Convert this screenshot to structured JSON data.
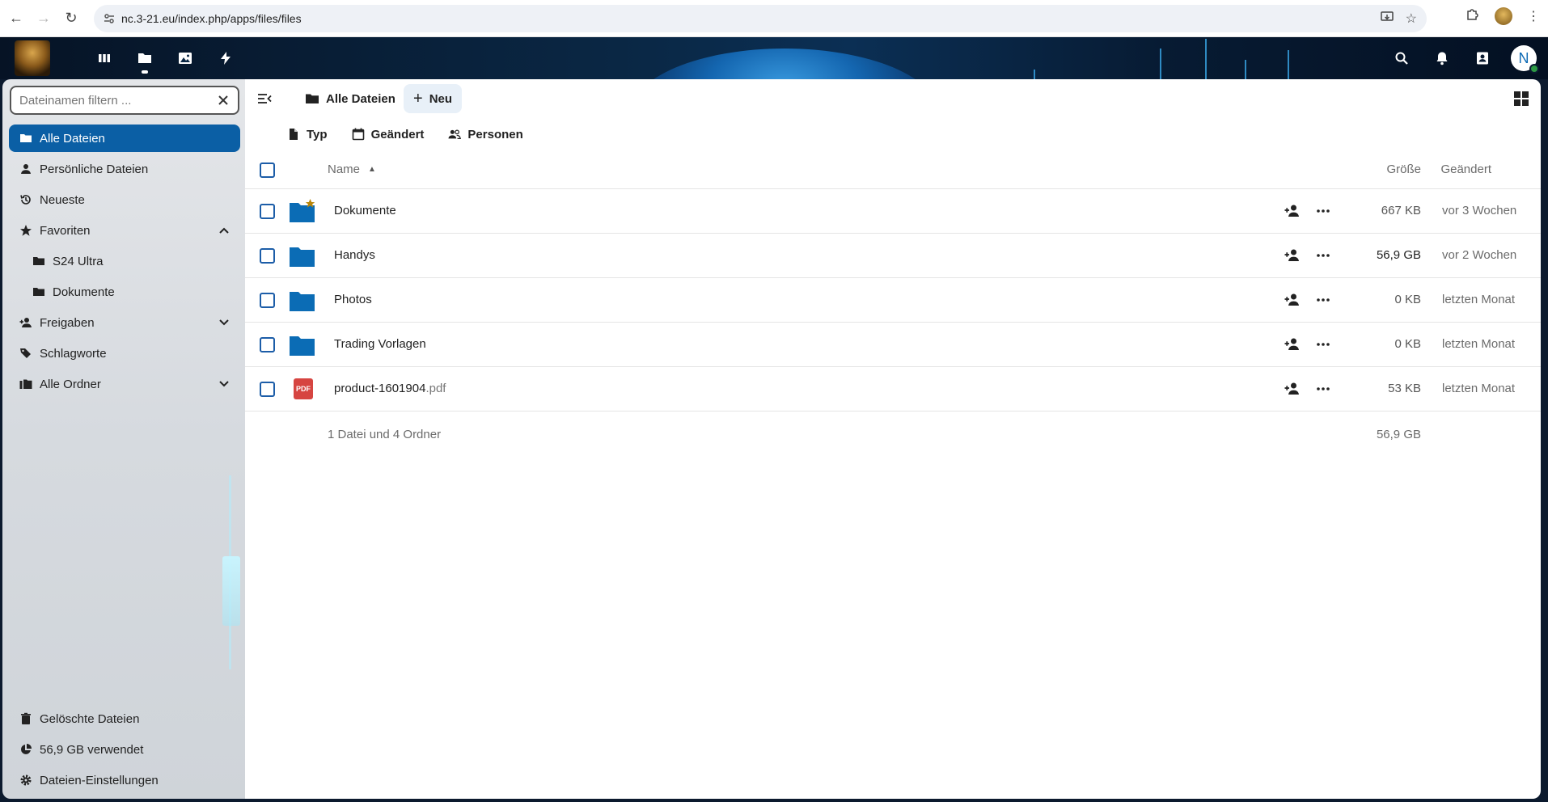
{
  "browser": {
    "url": "nc.3-21.eu/index.php/apps/files/files"
  },
  "sidebar": {
    "filter_placeholder": "Dateinamen filtern ...",
    "items": [
      {
        "label": "Alle Dateien",
        "icon": "folder-icon",
        "active": true
      },
      {
        "label": "Persönliche Dateien",
        "icon": "person-icon"
      },
      {
        "label": "Neueste",
        "icon": "history-icon"
      },
      {
        "label": "Favoriten",
        "icon": "star-icon"
      },
      {
        "label": "S24 Ultra",
        "icon": "folder-icon"
      },
      {
        "label": "Dokumente",
        "icon": "folder-icon"
      },
      {
        "label": "Freigaben",
        "icon": "share-icon"
      },
      {
        "label": "Schlagworte",
        "icon": "tag-icon"
      },
      {
        "label": "Alle Ordner",
        "icon": "folders-icon"
      }
    ],
    "bottom": {
      "trash": "Gelöschte Dateien",
      "quota": "56,9 GB verwendet",
      "settings": "Dateien-Einstellungen"
    }
  },
  "toolbar": {
    "breadcrumb": "Alle Dateien",
    "new_label": "Neu"
  },
  "filters": {
    "type": "Typ",
    "modified": "Geändert",
    "people": "Personen"
  },
  "table": {
    "headers": {
      "name": "Name",
      "size": "Größe",
      "modified": "Geändert"
    },
    "rows": [
      {
        "name": "Dokumente",
        "ext": "",
        "size": "667 KB",
        "modified": "vor 3 Wochen",
        "type": "folder",
        "favorite": true
      },
      {
        "name": "Handys",
        "ext": "",
        "size": "56,9 GB",
        "modified": "vor 2 Wochen",
        "type": "folder",
        "favorite": false
      },
      {
        "name": "Photos",
        "ext": "",
        "size": "0 KB",
        "modified": "letzten Monat",
        "type": "folder",
        "favorite": false
      },
      {
        "name": "Trading Vorlagen",
        "ext": "",
        "size": "0 KB",
        "modified": "letzten Monat",
        "type": "folder",
        "favorite": false
      },
      {
        "name": "product-1601904",
        "ext": ".pdf",
        "size": "53 KB",
        "modified": "letzten Monat",
        "type": "pdf",
        "favorite": false
      }
    ],
    "summary": {
      "count": "1 Datei und 4 Ordner",
      "total": "56,9 GB"
    }
  },
  "header": {
    "user_initial": "N"
  },
  "pdf_badge": "PDF",
  "colors": {
    "accent": "#0b5fa5",
    "folder": "#0b6cb5",
    "favorite_star": "#b8860b"
  }
}
